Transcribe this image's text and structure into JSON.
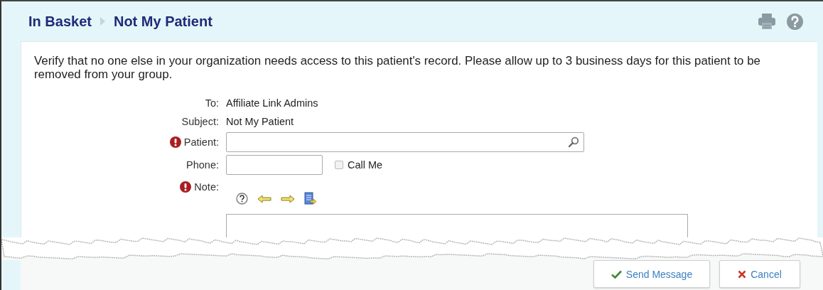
{
  "breadcrumb": [
    {
      "label": "In Basket"
    },
    {
      "label": "Not My Patient"
    }
  ],
  "instructions": "Verify that no one else in your organization needs access to this patient's record. Please allow up to 3 business days for this patient to be removed from your group.",
  "fields": [
    {
      "kind": "static",
      "label": "To:",
      "value": "Affiliate Link Admins",
      "required": false
    },
    {
      "kind": "static",
      "label": "Subject:",
      "value": "Not My Patient",
      "required": false
    },
    {
      "kind": "lookup",
      "label": "Patient:",
      "required": true
    },
    {
      "kind": "phone",
      "label": "Phone:",
      "required": false,
      "option": {
        "label": "Call Me",
        "checked": false
      }
    },
    {
      "kind": "note",
      "label": "Note:",
      "required": true
    }
  ],
  "buttons": [
    {
      "kind": "send",
      "label": "Send Message"
    },
    {
      "kind": "cancel",
      "label": "Cancel"
    }
  ]
}
